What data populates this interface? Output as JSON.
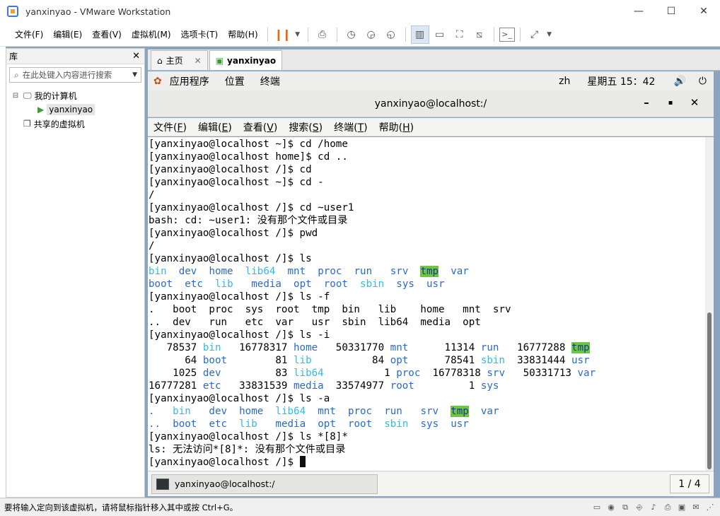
{
  "window": {
    "title": "yanxinyao - VMware Workstation"
  },
  "menubar": [
    "文件(F)",
    "编辑(E)",
    "查看(V)",
    "虚拟机(M)",
    "选项卡(T)",
    "帮助(H)"
  ],
  "library": {
    "title": "库",
    "search_placeholder": "在此处键入内容进行搜索",
    "tree": [
      {
        "label": "我的计算机",
        "level": 0,
        "toggle": "⊟",
        "icon": "monitor-icon"
      },
      {
        "label": "yanxinyao",
        "level": 1,
        "toggle": "",
        "icon": "vm-running-icon",
        "selected": true
      },
      {
        "label": "共享的虚拟机",
        "level": 0,
        "toggle": "",
        "icon": "shared-vm-icon"
      }
    ]
  },
  "tabs": [
    {
      "label": "主页",
      "icon": "home-icon",
      "active": false
    },
    {
      "label": "yanxinyao",
      "icon": "vm-icon",
      "active": true
    }
  ],
  "gnome": {
    "items": [
      "应用程序",
      "位置",
      "终端"
    ],
    "lang": "zh",
    "clock": "星期五 15：42"
  },
  "terminal": {
    "title": "yanxinyao@localhost:/",
    "menu": [
      {
        "text": "文件(",
        "key": "F",
        "end": ")"
      },
      {
        "text": "编辑(",
        "key": "E",
        "end": ")"
      },
      {
        "text": "查看(",
        "key": "V",
        "end": ")"
      },
      {
        "text": "搜索(",
        "key": "S",
        "end": ")"
      },
      {
        "text": "终端(",
        "key": "T",
        "end": ")"
      },
      {
        "text": "帮助(",
        "key": "H",
        "end": ")"
      }
    ],
    "lines": [
      [
        {
          "t": "[yanxinyao@localhost ~]$ cd /home"
        }
      ],
      [
        {
          "t": "[yanxinyao@localhost home]$ cd .."
        }
      ],
      [
        {
          "t": "[yanxinyao@localhost /]$ cd"
        }
      ],
      [
        {
          "t": "[yanxinyao@localhost ~]$ cd -"
        }
      ],
      [
        {
          "t": "/"
        }
      ],
      [
        {
          "t": "[yanxinyao@localhost /]$ cd ~user1"
        }
      ],
      [
        {
          "t": "bash: cd: ~user1: 没有那个文件或目录"
        }
      ],
      [
        {
          "t": "[yanxinyao@localhost /]$ pwd"
        }
      ],
      [
        {
          "t": "/"
        }
      ],
      [
        {
          "t": "[yanxinyao@localhost /]$ ls"
        }
      ],
      [
        {
          "t": "bin",
          "c": "c-cyan"
        },
        {
          "t": "  "
        },
        {
          "t": "dev",
          "c": "c-blue"
        },
        {
          "t": "  "
        },
        {
          "t": "home",
          "c": "c-blue"
        },
        {
          "t": "  "
        },
        {
          "t": "lib64",
          "c": "c-cyan"
        },
        {
          "t": "  "
        },
        {
          "t": "mnt",
          "c": "c-blue"
        },
        {
          "t": "  "
        },
        {
          "t": "proc",
          "c": "c-blue"
        },
        {
          "t": "  "
        },
        {
          "t": "run",
          "c": "c-blue"
        },
        {
          "t": "   "
        },
        {
          "t": "srv",
          "c": "c-blue"
        },
        {
          "t": "  "
        },
        {
          "t": "tmp",
          "c": "c-tmp"
        },
        {
          "t": "  "
        },
        {
          "t": "var",
          "c": "c-blue"
        }
      ],
      [
        {
          "t": "boot",
          "c": "c-blue"
        },
        {
          "t": "  "
        },
        {
          "t": "etc",
          "c": "c-blue"
        },
        {
          "t": "  "
        },
        {
          "t": "lib",
          "c": "c-cyan"
        },
        {
          "t": "   "
        },
        {
          "t": "media",
          "c": "c-blue"
        },
        {
          "t": "  "
        },
        {
          "t": "opt",
          "c": "c-blue"
        },
        {
          "t": "  "
        },
        {
          "t": "root",
          "c": "c-blue"
        },
        {
          "t": "  "
        },
        {
          "t": "sbin",
          "c": "c-cyan"
        },
        {
          "t": "  "
        },
        {
          "t": "sys",
          "c": "c-blue"
        },
        {
          "t": "  "
        },
        {
          "t": "usr",
          "c": "c-blue"
        }
      ],
      [
        {
          "t": "[yanxinyao@localhost /]$ ls -f"
        }
      ],
      [
        {
          "t": ".   boot  proc  sys  root  tmp  bin   lib    home   mnt  srv"
        }
      ],
      [
        {
          "t": "..  dev   run   etc  var   usr  sbin  lib64  media  opt"
        }
      ],
      [
        {
          "t": "[yanxinyao@localhost /]$ ls -i"
        }
      ],
      [
        {
          "t": "   78537 "
        },
        {
          "t": "bin",
          "c": "c-cyan"
        },
        {
          "t": "   16778317 "
        },
        {
          "t": "home",
          "c": "c-blue"
        },
        {
          "t": "   50331770 "
        },
        {
          "t": "mnt",
          "c": "c-blue"
        },
        {
          "t": "      11314 "
        },
        {
          "t": "run",
          "c": "c-blue"
        },
        {
          "t": "   16777288 "
        },
        {
          "t": "tmp",
          "c": "c-tmp"
        }
      ],
      [
        {
          "t": "      64 "
        },
        {
          "t": "boot",
          "c": "c-blue"
        },
        {
          "t": "        81 "
        },
        {
          "t": "lib",
          "c": "c-cyan"
        },
        {
          "t": "          84 "
        },
        {
          "t": "opt",
          "c": "c-blue"
        },
        {
          "t": "      78541 "
        },
        {
          "t": "sbin",
          "c": "c-cyan"
        },
        {
          "t": "  33831444 "
        },
        {
          "t": "usr",
          "c": "c-blue"
        }
      ],
      [
        {
          "t": "    1025 "
        },
        {
          "t": "dev",
          "c": "c-blue"
        },
        {
          "t": "         83 "
        },
        {
          "t": "lib64",
          "c": "c-cyan"
        },
        {
          "t": "          1 "
        },
        {
          "t": "proc",
          "c": "c-blue"
        },
        {
          "t": "  16778318 "
        },
        {
          "t": "srv",
          "c": "c-blue"
        },
        {
          "t": "   50331713 "
        },
        {
          "t": "var",
          "c": "c-blue"
        }
      ],
      [
        {
          "t": "16777281 "
        },
        {
          "t": "etc",
          "c": "c-blue"
        },
        {
          "t": "   33831539 "
        },
        {
          "t": "media",
          "c": "c-blue"
        },
        {
          "t": "  33574977 "
        },
        {
          "t": "root",
          "c": "c-blue"
        },
        {
          "t": "         1 "
        },
        {
          "t": "sys",
          "c": "c-blue"
        }
      ],
      [
        {
          "t": "[yanxinyao@localhost /]$ ls -a"
        }
      ],
      [
        {
          "t": ".",
          "c": "c-blue"
        },
        {
          "t": "   "
        },
        {
          "t": "bin",
          "c": "c-cyan"
        },
        {
          "t": "   "
        },
        {
          "t": "dev",
          "c": "c-blue"
        },
        {
          "t": "  "
        },
        {
          "t": "home",
          "c": "c-blue"
        },
        {
          "t": "  "
        },
        {
          "t": "lib64",
          "c": "c-cyan"
        },
        {
          "t": "  "
        },
        {
          "t": "mnt",
          "c": "c-blue"
        },
        {
          "t": "  "
        },
        {
          "t": "proc",
          "c": "c-blue"
        },
        {
          "t": "  "
        },
        {
          "t": "run",
          "c": "c-blue"
        },
        {
          "t": "   "
        },
        {
          "t": "srv",
          "c": "c-blue"
        },
        {
          "t": "  "
        },
        {
          "t": "tmp",
          "c": "c-tmp"
        },
        {
          "t": "  "
        },
        {
          "t": "var",
          "c": "c-blue"
        }
      ],
      [
        {
          "t": "..",
          "c": "c-blue"
        },
        {
          "t": "  "
        },
        {
          "t": "boot",
          "c": "c-blue"
        },
        {
          "t": "  "
        },
        {
          "t": "etc",
          "c": "c-blue"
        },
        {
          "t": "  "
        },
        {
          "t": "lib",
          "c": "c-cyan"
        },
        {
          "t": "   "
        },
        {
          "t": "media",
          "c": "c-blue"
        },
        {
          "t": "  "
        },
        {
          "t": "opt",
          "c": "c-blue"
        },
        {
          "t": "  "
        },
        {
          "t": "root",
          "c": "c-blue"
        },
        {
          "t": "  "
        },
        {
          "t": "sbin",
          "c": "c-cyan"
        },
        {
          "t": "  "
        },
        {
          "t": "sys",
          "c": "c-blue"
        },
        {
          "t": "  "
        },
        {
          "t": "usr",
          "c": "c-blue"
        }
      ],
      [
        {
          "t": "[yanxinyao@localhost /]$ ls *[8]*"
        }
      ],
      [
        {
          "t": "ls: 无法访问*[8]*: 没有那个文件或目录"
        }
      ],
      [
        {
          "t": "[yanxinyao@localhost /]$ "
        },
        {
          "t": "",
          "c": "cursor"
        }
      ]
    ],
    "task_label": "yanxinyao@localhost:/",
    "pager": "1 / 4"
  },
  "statusbar": {
    "message": "要将输入定向到该虚拟机，请将鼠标指针移入其中或按 Ctrl+G。"
  },
  "colors": {
    "dir": "#2a6ac9",
    "link": "#35b8e6",
    "sticky_bg": "#6cc644"
  }
}
